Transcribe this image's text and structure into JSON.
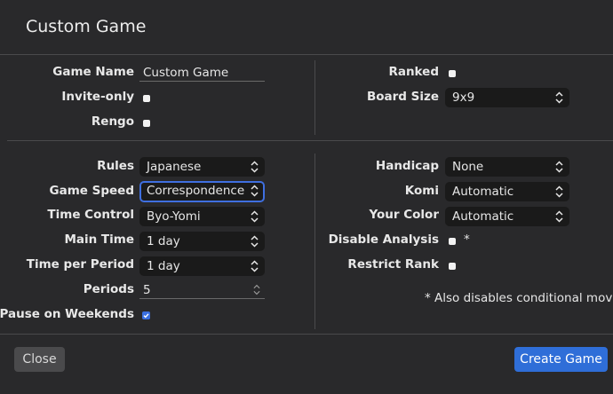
{
  "dialog": {
    "title": "Custom Game"
  },
  "top_left": {
    "game_name_label": "Game Name",
    "game_name_value": "Custom Game",
    "invite_only_label": "Invite-only",
    "invite_only_checked": false,
    "rengo_label": "Rengo",
    "rengo_checked": false
  },
  "top_right": {
    "ranked_label": "Ranked",
    "ranked_checked": false,
    "board_size_label": "Board Size",
    "board_size_value": "9x9"
  },
  "bottom_left": {
    "rules_label": "Rules",
    "rules_value": "Japanese",
    "game_speed_label": "Game Speed",
    "game_speed_value": "Correspondence",
    "time_control_label": "Time Control",
    "time_control_value": "Byo-Yomi",
    "main_time_label": "Main Time",
    "main_time_value": "1 day",
    "time_per_period_label": "Time per Period",
    "time_per_period_value": "1 day",
    "periods_label": "Periods",
    "periods_value": "5",
    "pause_on_weekends_label": "Pause on Weekends",
    "pause_on_weekends_checked": true
  },
  "bottom_right": {
    "handicap_label": "Handicap",
    "handicap_value": "None",
    "komi_label": "Komi",
    "komi_value": "Automatic",
    "your_color_label": "Your Color",
    "your_color_value": "Automatic",
    "disable_analysis_label": "Disable Analysis",
    "disable_analysis_checked": false,
    "disable_analysis_marker": "*",
    "restrict_rank_label": "Restrict Rank",
    "restrict_rank_checked": false,
    "note": "* Also disables conditional moves"
  },
  "footer": {
    "close_label": "Close",
    "create_label": "Create Game"
  },
  "colors": {
    "background": "#29292b",
    "select_bg": "#1a1a1a",
    "accent": "#2f6ed8",
    "focus_ring": "#3f6fe0",
    "divider": "#4a4a4c"
  }
}
